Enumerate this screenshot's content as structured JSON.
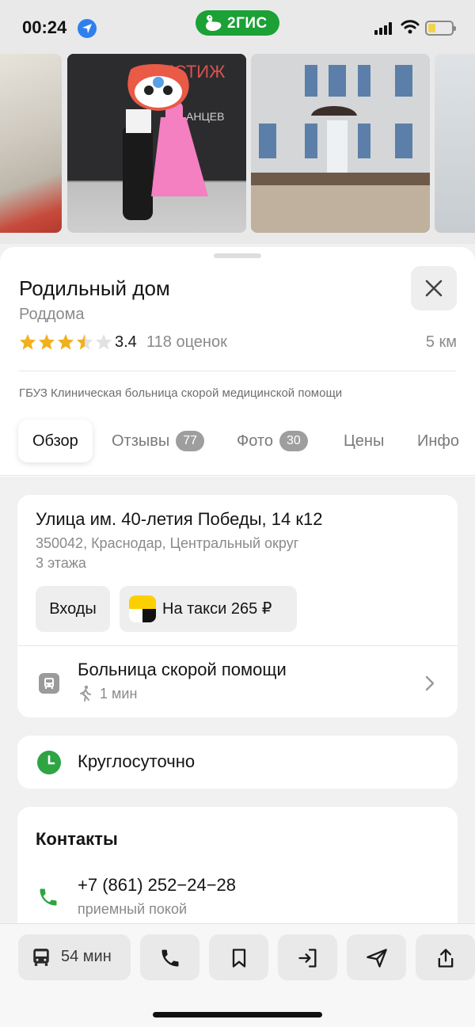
{
  "status_bar": {
    "time": "00:24",
    "brand": "2ГИС",
    "icons": [
      "location-arrow-icon",
      "signal-icon",
      "wifi-icon",
      "battery-icon"
    ]
  },
  "place": {
    "title": "Родильный дом",
    "category": "Роддома",
    "rating": 3.4,
    "rating_text": "3.4",
    "reviews_count_text": "118 оценок",
    "distance": "5 км",
    "organization": "ГБУЗ Клиническая больница скорой медицинской помощи"
  },
  "tabs": [
    {
      "label": "Обзор",
      "badge": ""
    },
    {
      "label": "Отзывы",
      "badge": "77"
    },
    {
      "label": "Фото",
      "badge": "30"
    },
    {
      "label": "Цены",
      "badge": ""
    },
    {
      "label": "Инфо",
      "badge": ""
    }
  ],
  "address": {
    "street": "Улица им. 40-летия Победы, 14 к12",
    "city": "350042, Краснодар, Центральный округ",
    "floors": "3 этажа",
    "entrances_label": "Входы",
    "taxi_label": "На такси 265 ₽",
    "stop_name": "Больница скорой помощи",
    "walk_time": "1 мин"
  },
  "hours": {
    "text": "Круглосуточно"
  },
  "contacts": {
    "title": "Контакты",
    "phone": "+7 (861) 252−24−28",
    "phone_note": "приемный покой"
  },
  "actions": {
    "route_time": "54 мин"
  },
  "colors": {
    "brand_green": "#1ba136",
    "star": "#f2b01e",
    "clock_green": "#2ea443",
    "phone_green": "#2ea443"
  }
}
